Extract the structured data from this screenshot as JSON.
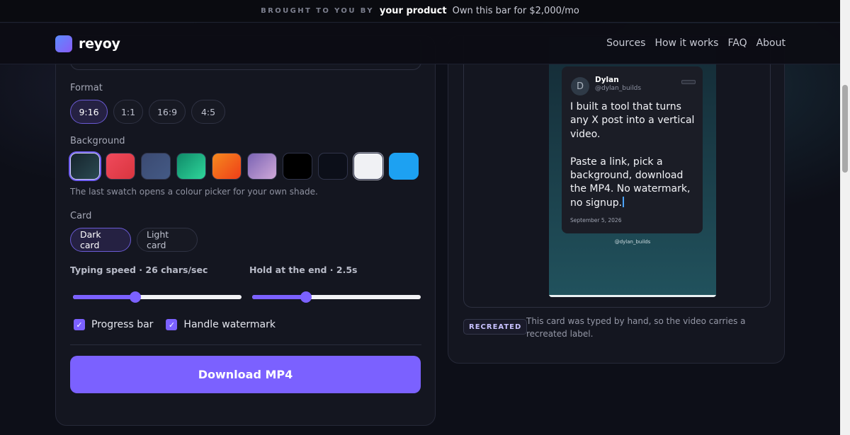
{
  "banner": {
    "kicker": "BROUGHT TO YOU BY",
    "product": "your product",
    "offer": "Own this bar for $2,000/mo"
  },
  "header": {
    "logo": "reyoy",
    "nav": [
      "Sources",
      "How it works",
      "FAQ",
      "About"
    ]
  },
  "settings": {
    "format": {
      "label": "Format",
      "options": [
        "9:16",
        "1:1",
        "16:9",
        "4:5"
      ],
      "selected": "9:16"
    },
    "background": {
      "label": "Background",
      "swatches": [
        {
          "name": "teal-gradient",
          "color": "#1f3a44"
        },
        {
          "name": "red",
          "color": "#e8404f"
        },
        {
          "name": "slate-blue",
          "color": "#3c4d78"
        },
        {
          "name": "green-gradient",
          "color": "#1fb884"
        },
        {
          "name": "orange",
          "color": "#f0571c"
        },
        {
          "name": "lavender",
          "color": "#a07ec4"
        },
        {
          "name": "black",
          "color": "#000000"
        },
        {
          "name": "midnight",
          "color": "#0c0f19"
        },
        {
          "name": "white",
          "color": "#f0f1f4"
        },
        {
          "name": "custom-blue",
          "color": "#1da1f2"
        }
      ],
      "selected_index": 0,
      "hint": "The last swatch opens a colour picker for your own shade."
    },
    "card": {
      "label": "Card",
      "options": [
        "Dark card",
        "Light card"
      ],
      "selected": "Dark card"
    },
    "typing_speed": {
      "label": "Typing speed · 26 chars/sec",
      "fraction": 0.37
    },
    "hold": {
      "label": "Hold at the end · 2.5s",
      "fraction": 0.32
    },
    "checkboxes": [
      {
        "label": "Progress bar",
        "checked": true
      },
      {
        "label": "Handle watermark",
        "checked": true
      }
    ],
    "download_label": "Download MP4"
  },
  "preview": {
    "avatar_letter": "D",
    "name": "Dylan",
    "handle": "@dylan_builds",
    "body": "I built a tool that turns any X post into a vertical video.\n\nPaste a link, pick a background, download the MP4. No watermark, no signup.",
    "date": "September 5, 2026",
    "watermark_handle": "@dylan_builds",
    "badge": "RECREATED",
    "note": "This card was typed by hand, so the video carries a recreated label."
  },
  "colors": {
    "accent": "#7b61ff",
    "background": "#0d0f18",
    "panel": "#141620"
  }
}
